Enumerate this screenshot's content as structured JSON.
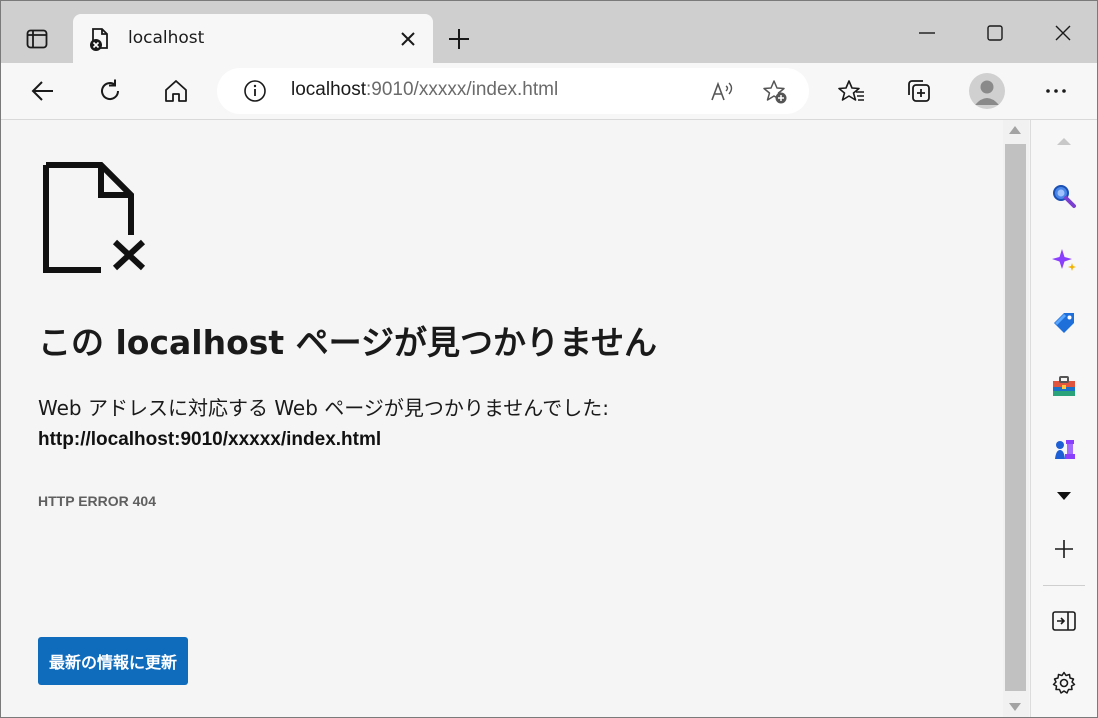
{
  "tab": {
    "title": "localhost",
    "favicon": "page-error-icon"
  },
  "address": {
    "host": "localhost",
    "rest": ":9010/xxxxx/index.html"
  },
  "error": {
    "heading": "この localhost ページが見つかりません",
    "description": "Web アドレスに対応する Web ページが見つかりませんでした:",
    "url": "http://localhost:9010/xxxxx/index.html",
    "code": "HTTP ERROR 404",
    "reload_label": "最新の情報に更新"
  },
  "colors": {
    "accent": "#0f6cbd",
    "titlebar": "#cfcfcf",
    "page_bg": "#f5f5f5"
  },
  "sidebar": {
    "icons": [
      "search-icon",
      "copilot-sparkle-icon",
      "shopping-tag-icon",
      "tools-briefcase-icon",
      "games-chess-icon",
      "more-down-icon",
      "add-icon",
      "hide-sidebar-icon",
      "settings-gear-icon"
    ]
  }
}
